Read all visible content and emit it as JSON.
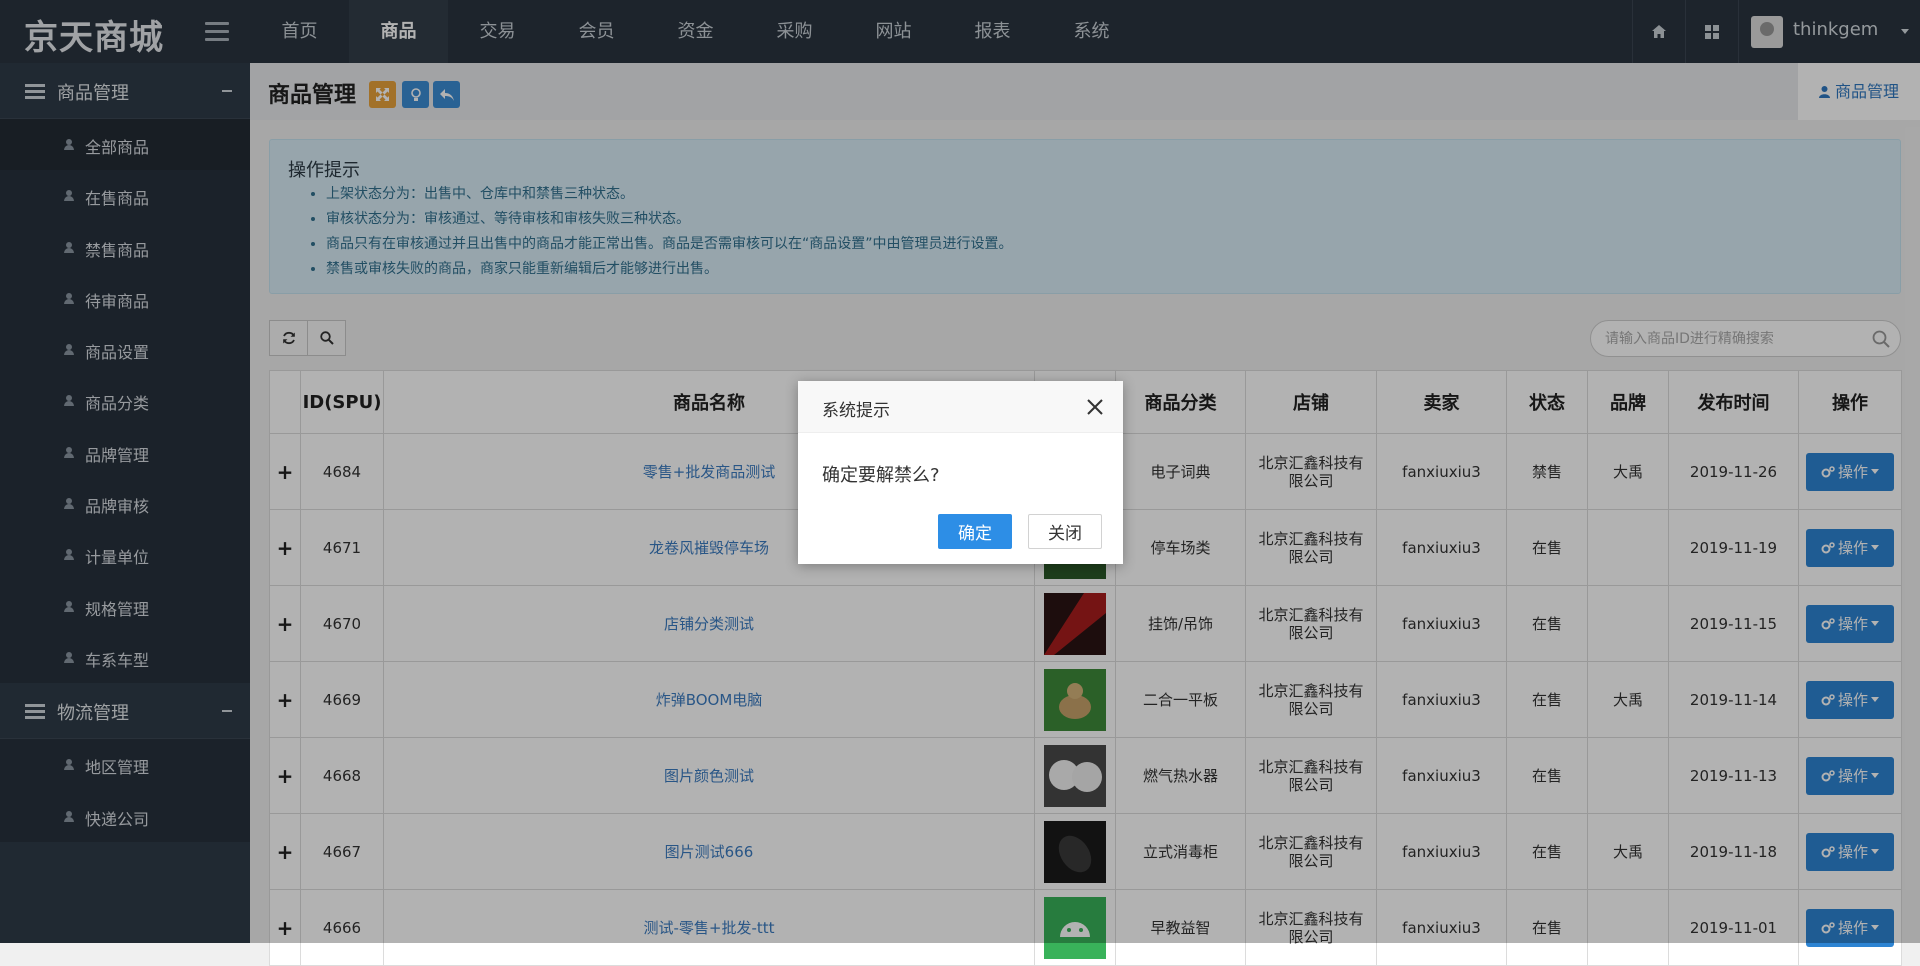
{
  "brand": {
    "name": "京天商城"
  },
  "nav": [
    "首页",
    "商品",
    "交易",
    "会员",
    "资金",
    "采购",
    "网站",
    "报表",
    "系统"
  ],
  "user": {
    "name": "thinkgem"
  },
  "sidebar": {
    "groups": [
      {
        "label": "商品管理",
        "items": [
          "全部商品",
          "在售商品",
          "禁售商品",
          "待审商品",
          "商品设置",
          "商品分类",
          "品牌管理",
          "品牌审核",
          "计量单位",
          "规格管理",
          "车系车型"
        ]
      },
      {
        "label": "物流管理",
        "items": [
          "地区管理",
          "快递公司"
        ]
      }
    ]
  },
  "page": {
    "title": "商品管理",
    "breadcrumb": "商品管理"
  },
  "tips": {
    "title": "操作提示",
    "items": [
      "上架状态分为：出售中、仓库中和禁售三种状态。",
      "审核状态分为：审核通过、等待审核和审核失败三种状态。",
      "商品只有在审核通过并且出售中的商品才能正常出售。商品是否需审核可以在“商品设置”中由管理员进行设置。",
      "禁售或审核失败的商品，商家只能重新编辑后才能够进行出售。"
    ]
  },
  "search": {
    "placeholder": "请输入商品ID进行精确搜索"
  },
  "table": {
    "headers": [
      "",
      "ID(SPU)",
      "商品名称",
      "",
      "商品分类",
      "店铺",
      "卖家",
      "状态",
      "品牌",
      "发布时间",
      "操作"
    ],
    "op_label": "操作",
    "rows": [
      {
        "id": "4684",
        "name": "零售+批发商品测试",
        "category": "电子词典",
        "shop": "北京汇鑫科技有限公司",
        "seller": "fanxiuxiu3",
        "status": "禁售",
        "brand": "大禹",
        "date": "2019-11-26",
        "thumb": "none"
      },
      {
        "id": "4671",
        "name": "龙卷风摧毁停车场",
        "category": "停车场类",
        "shop": "北京汇鑫科技有限公司",
        "seller": "fanxiuxiu3",
        "status": "在售",
        "brand": "",
        "date": "2019-11-19",
        "thumb": "green"
      },
      {
        "id": "4670",
        "name": "店铺分类测试",
        "category": "挂饰/吊饰",
        "shop": "北京汇鑫科技有限公司",
        "seller": "fanxiuxiu3",
        "status": "在售",
        "brand": "",
        "date": "2019-11-15",
        "thumb": "red"
      },
      {
        "id": "4669",
        "name": "炸弹BOOM电脑",
        "category": "二合一平板",
        "shop": "北京汇鑫科技有限公司",
        "seller": "fanxiuxiu3",
        "status": "在售",
        "brand": "大禹",
        "date": "2019-11-14",
        "thumb": "dog"
      },
      {
        "id": "4668",
        "name": "图片颜色测试",
        "category": "燃气热水器",
        "shop": "北京汇鑫科技有限公司",
        "seller": "fanxiuxiu3",
        "status": "在售",
        "brand": "",
        "date": "2019-11-13",
        "thumb": "white"
      },
      {
        "id": "4667",
        "name": "图片测试666",
        "category": "立式消毒柜",
        "shop": "北京汇鑫科技有限公司",
        "seller": "fanxiuxiu3",
        "status": "在售",
        "brand": "大禹",
        "date": "2019-11-18",
        "thumb": "mouse"
      },
      {
        "id": "4666",
        "name": "测试-零售+批发-ttt",
        "category": "早教益智",
        "shop": "北京汇鑫科技有限公司",
        "seller": "fanxiuxiu3",
        "status": "在售",
        "brand": "",
        "date": "2019-11-01",
        "thumb": "android"
      }
    ]
  },
  "dialog": {
    "title": "系统提示",
    "message": "确定要解禁么?",
    "confirm": "确定",
    "cancel": "关闭"
  }
}
